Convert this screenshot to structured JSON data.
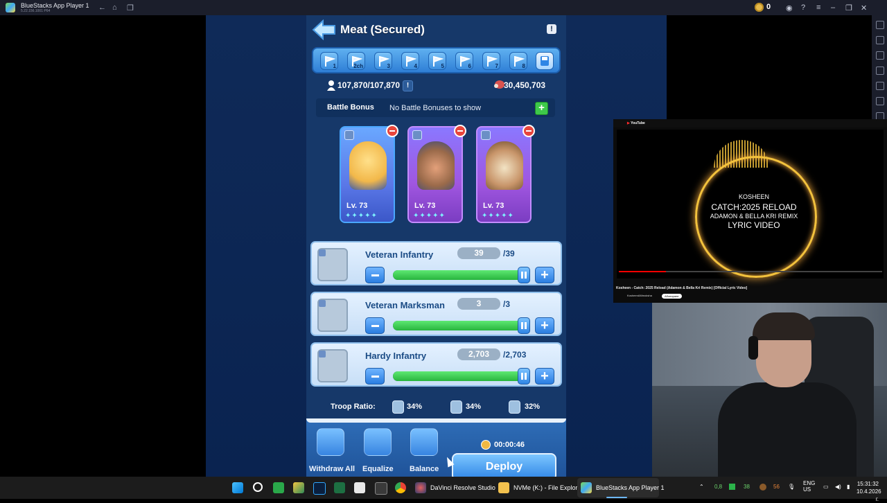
{
  "window": {
    "title": "BlueStacks App Player 1",
    "subtitle": "5.22.156.1001 P64",
    "coins": "0"
  },
  "game": {
    "title": "Meat (Secured)",
    "info": "!",
    "flags": [
      "1",
      "2ch",
      "3",
      "4",
      "5",
      "6",
      "7",
      "8"
    ],
    "troop_capacity": "107,870/107,870",
    "capacity_info": "!",
    "meat": "30,450,703",
    "bonus_label": "Battle Bonus",
    "bonus_text": "No Battle Bonuses to show",
    "bonus_add": "+",
    "heroes": [
      {
        "level": "Lv. 73",
        "stars": "✦✦✦✦✦"
      },
      {
        "level": "Lv. 73",
        "stars": "✦✦✦✦✦"
      },
      {
        "level": "Lv. 73",
        "stars": "✦✦✦✦✦"
      }
    ],
    "troops": [
      {
        "name": "Veteran Infantry",
        "count": "39",
        "max": "/39",
        "fill": 1.0
      },
      {
        "name": "Veteran Marksman",
        "count": "3",
        "max": "/3",
        "fill": 1.0
      },
      {
        "name": "Hardy Infantry",
        "count": "2,703",
        "max": "/2,703",
        "fill": 1.0
      }
    ],
    "ratio_label": "Troop Ratio:",
    "ratios": [
      "34%",
      "34%",
      "32%"
    ],
    "actions": [
      "Withdraw All",
      "Equalize",
      "Balance"
    ],
    "timer": "00:00:46",
    "deploy": "Deploy"
  },
  "youtube": {
    "logo": "YouTube",
    "artist": "KOSHEEN",
    "song": "CATCH:2025 RELOAD",
    "remix": "ADAMON & BELLA KRI REMIX",
    "kind": "LYRIC VIDEO",
    "video_title": "Kosheen - Catch: 2025 Reload (Adamon & Bella Kri Remix) [Official Lyric Video]",
    "channel": "KosheenAMmoksha",
    "subscribe": "Абониране",
    "progress": 0.18
  },
  "taskbar": {
    "apps": [
      "DaVinci Resolve Studio",
      "NVMe (K:) - File Explore",
      "BlueStacks App Player 1"
    ],
    "tray_items": [
      "0,8",
      "38",
      "56"
    ],
    "lang": "ENG",
    "region": "US",
    "time": "15:31:32",
    "date": "10.4.2026 г."
  },
  "colors": {
    "panel": "#163869",
    "accent": "#2f85e5",
    "green": "#3ec94a",
    "remove": "#e8453c"
  }
}
